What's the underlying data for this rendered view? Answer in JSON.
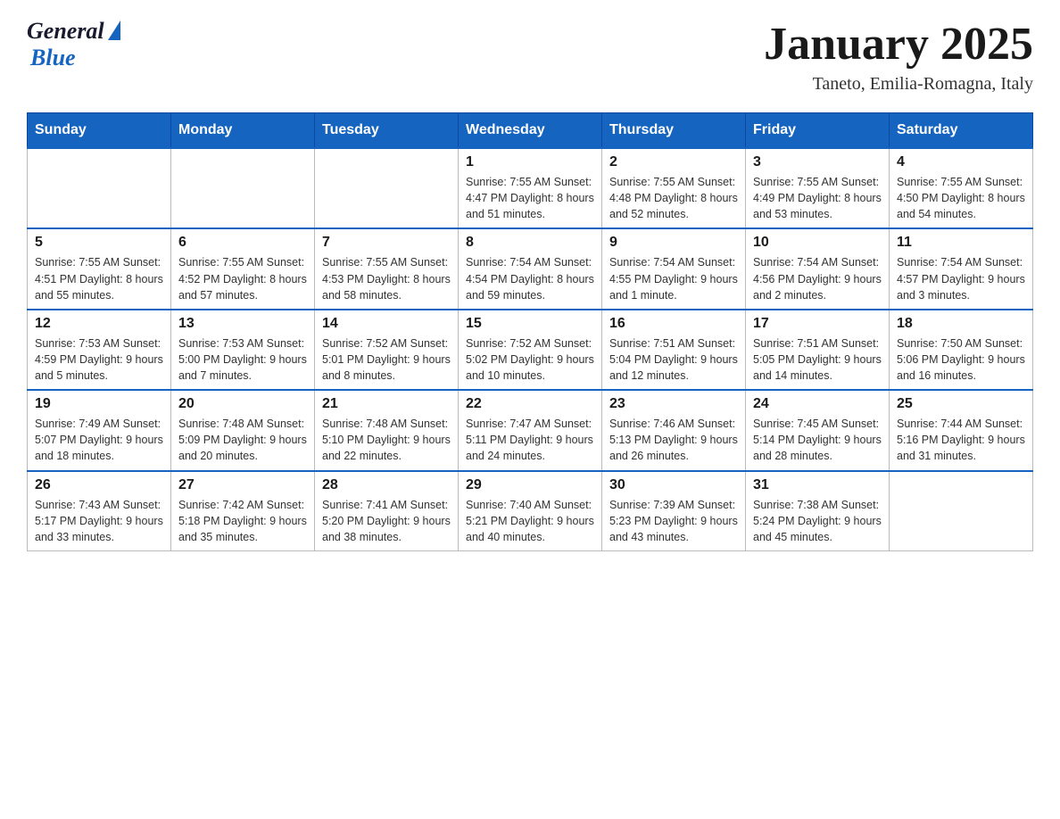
{
  "header": {
    "logo": {
      "general": "General",
      "blue": "Blue"
    },
    "title": "January 2025",
    "location": "Taneto, Emilia-Romagna, Italy"
  },
  "days_of_week": [
    "Sunday",
    "Monday",
    "Tuesday",
    "Wednesday",
    "Thursday",
    "Friday",
    "Saturday"
  ],
  "weeks": [
    [
      {
        "day": "",
        "info": ""
      },
      {
        "day": "",
        "info": ""
      },
      {
        "day": "",
        "info": ""
      },
      {
        "day": "1",
        "info": "Sunrise: 7:55 AM\nSunset: 4:47 PM\nDaylight: 8 hours\nand 51 minutes."
      },
      {
        "day": "2",
        "info": "Sunrise: 7:55 AM\nSunset: 4:48 PM\nDaylight: 8 hours\nand 52 minutes."
      },
      {
        "day": "3",
        "info": "Sunrise: 7:55 AM\nSunset: 4:49 PM\nDaylight: 8 hours\nand 53 minutes."
      },
      {
        "day": "4",
        "info": "Sunrise: 7:55 AM\nSunset: 4:50 PM\nDaylight: 8 hours\nand 54 minutes."
      }
    ],
    [
      {
        "day": "5",
        "info": "Sunrise: 7:55 AM\nSunset: 4:51 PM\nDaylight: 8 hours\nand 55 minutes."
      },
      {
        "day": "6",
        "info": "Sunrise: 7:55 AM\nSunset: 4:52 PM\nDaylight: 8 hours\nand 57 minutes."
      },
      {
        "day": "7",
        "info": "Sunrise: 7:55 AM\nSunset: 4:53 PM\nDaylight: 8 hours\nand 58 minutes."
      },
      {
        "day": "8",
        "info": "Sunrise: 7:54 AM\nSunset: 4:54 PM\nDaylight: 8 hours\nand 59 minutes."
      },
      {
        "day": "9",
        "info": "Sunrise: 7:54 AM\nSunset: 4:55 PM\nDaylight: 9 hours\nand 1 minute."
      },
      {
        "day": "10",
        "info": "Sunrise: 7:54 AM\nSunset: 4:56 PM\nDaylight: 9 hours\nand 2 minutes."
      },
      {
        "day": "11",
        "info": "Sunrise: 7:54 AM\nSunset: 4:57 PM\nDaylight: 9 hours\nand 3 minutes."
      }
    ],
    [
      {
        "day": "12",
        "info": "Sunrise: 7:53 AM\nSunset: 4:59 PM\nDaylight: 9 hours\nand 5 minutes."
      },
      {
        "day": "13",
        "info": "Sunrise: 7:53 AM\nSunset: 5:00 PM\nDaylight: 9 hours\nand 7 minutes."
      },
      {
        "day": "14",
        "info": "Sunrise: 7:52 AM\nSunset: 5:01 PM\nDaylight: 9 hours\nand 8 minutes."
      },
      {
        "day": "15",
        "info": "Sunrise: 7:52 AM\nSunset: 5:02 PM\nDaylight: 9 hours\nand 10 minutes."
      },
      {
        "day": "16",
        "info": "Sunrise: 7:51 AM\nSunset: 5:04 PM\nDaylight: 9 hours\nand 12 minutes."
      },
      {
        "day": "17",
        "info": "Sunrise: 7:51 AM\nSunset: 5:05 PM\nDaylight: 9 hours\nand 14 minutes."
      },
      {
        "day": "18",
        "info": "Sunrise: 7:50 AM\nSunset: 5:06 PM\nDaylight: 9 hours\nand 16 minutes."
      }
    ],
    [
      {
        "day": "19",
        "info": "Sunrise: 7:49 AM\nSunset: 5:07 PM\nDaylight: 9 hours\nand 18 minutes."
      },
      {
        "day": "20",
        "info": "Sunrise: 7:48 AM\nSunset: 5:09 PM\nDaylight: 9 hours\nand 20 minutes."
      },
      {
        "day": "21",
        "info": "Sunrise: 7:48 AM\nSunset: 5:10 PM\nDaylight: 9 hours\nand 22 minutes."
      },
      {
        "day": "22",
        "info": "Sunrise: 7:47 AM\nSunset: 5:11 PM\nDaylight: 9 hours\nand 24 minutes."
      },
      {
        "day": "23",
        "info": "Sunrise: 7:46 AM\nSunset: 5:13 PM\nDaylight: 9 hours\nand 26 minutes."
      },
      {
        "day": "24",
        "info": "Sunrise: 7:45 AM\nSunset: 5:14 PM\nDaylight: 9 hours\nand 28 minutes."
      },
      {
        "day": "25",
        "info": "Sunrise: 7:44 AM\nSunset: 5:16 PM\nDaylight: 9 hours\nand 31 minutes."
      }
    ],
    [
      {
        "day": "26",
        "info": "Sunrise: 7:43 AM\nSunset: 5:17 PM\nDaylight: 9 hours\nand 33 minutes."
      },
      {
        "day": "27",
        "info": "Sunrise: 7:42 AM\nSunset: 5:18 PM\nDaylight: 9 hours\nand 35 minutes."
      },
      {
        "day": "28",
        "info": "Sunrise: 7:41 AM\nSunset: 5:20 PM\nDaylight: 9 hours\nand 38 minutes."
      },
      {
        "day": "29",
        "info": "Sunrise: 7:40 AM\nSunset: 5:21 PM\nDaylight: 9 hours\nand 40 minutes."
      },
      {
        "day": "30",
        "info": "Sunrise: 7:39 AM\nSunset: 5:23 PM\nDaylight: 9 hours\nand 43 minutes."
      },
      {
        "day": "31",
        "info": "Sunrise: 7:38 AM\nSunset: 5:24 PM\nDaylight: 9 hours\nand 45 minutes."
      },
      {
        "day": "",
        "info": ""
      }
    ]
  ]
}
